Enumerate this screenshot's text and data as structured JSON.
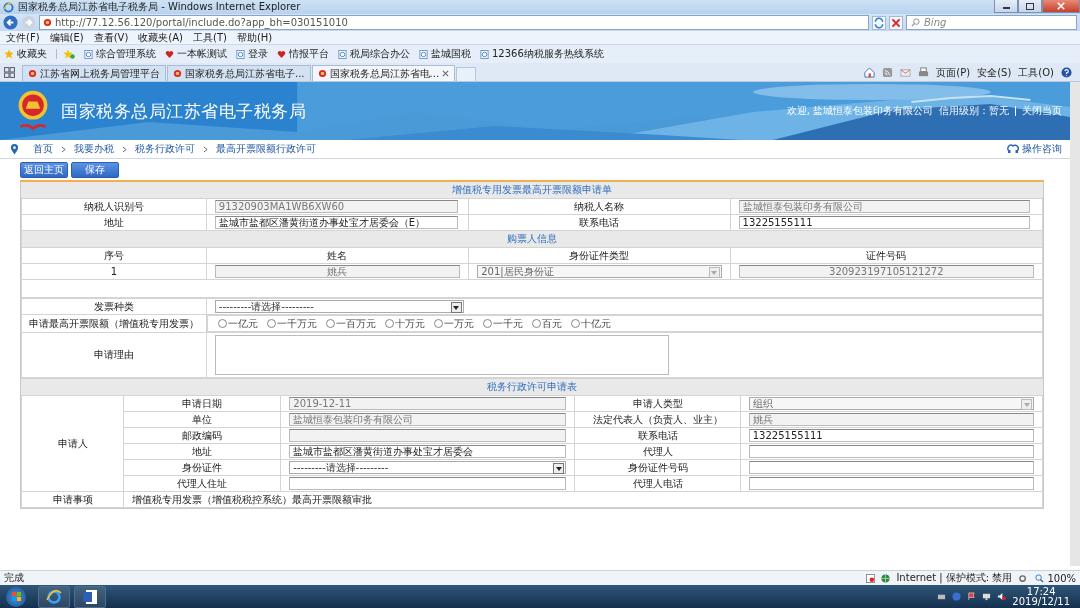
{
  "window": {
    "title": "国家税务总局江苏省电子税务局 - Windows Internet Explorer"
  },
  "address_bar": {
    "url": "http://77.12.56.120/portal/include.do?app_bh=030151010",
    "search_placeholder": "Bing"
  },
  "menu": [
    "文件(F)",
    "编辑(E)",
    "查看(V)",
    "收藏夹(A)",
    "工具(T)",
    "帮助(H)"
  ],
  "favorites": {
    "label": "收藏夹",
    "items": [
      {
        "label": "综合管理系统",
        "kind": "page"
      },
      {
        "label": "一本帐测试",
        "kind": "emblem"
      },
      {
        "label": "登录",
        "kind": "page"
      },
      {
        "label": "情报平台",
        "kind": "emblem"
      },
      {
        "label": "税局综合办公",
        "kind": "page"
      },
      {
        "label": "盐城国税",
        "kind": "page"
      },
      {
        "label": "12366纳税服务热线系统",
        "kind": "page"
      }
    ]
  },
  "browser_tabs": [
    {
      "label": "江苏省网上税务局管理平台",
      "selected": false
    },
    {
      "label": "国家税务总局江苏省电子...",
      "selected": false
    },
    {
      "label": "国家税务总局江苏省电...",
      "selected": true
    }
  ],
  "command_bar": [
    "页面(P)",
    "安全(S)",
    "工具(O)"
  ],
  "site_header": {
    "title": "国家税务总局江苏省电子税务局",
    "welcome": "欢迎, 盐城恒泰包装印务有限公司",
    "credit": "信用级别：暂无",
    "close_link": "关闭当页"
  },
  "breadcrumb": [
    "首页",
    "我要办税",
    "税务行政许可",
    "最高开票限额行政许可"
  ],
  "help_link": "操作咨询",
  "buttons": [
    "返回主页",
    "保存"
  ],
  "form": {
    "title": "增值税专用发票最高开票限额申请单",
    "taxpayer": [
      {
        "label": "纳税人识别号",
        "kind": "input",
        "value": "91320903MA1WB6XW60",
        "disabled": true
      },
      {
        "label": "纳税人名称",
        "kind": "input",
        "value": "盐城恒泰包装印务有限公司",
        "disabled": true
      },
      {
        "label": "地址",
        "kind": "input",
        "value": "盐城市盐都区潘黄街道办事处宝才居委会（E）",
        "disabled": false
      },
      {
        "label": "联系电话",
        "kind": "input",
        "value": "13225155111",
        "disabled": false
      }
    ],
    "buyer": {
      "title": "购票人信息",
      "columns": [
        "序号",
        "姓名",
        "身份证件类型",
        "证件号码"
      ],
      "rows": [
        [
          {
            "kind": "text",
            "value": "1"
          },
          {
            "kind": "input",
            "value": "姚兵",
            "disabled": true
          },
          {
            "kind": "select",
            "value": "201|居民身份证",
            "disabled": true
          },
          {
            "kind": "input",
            "value": "320923197105121272",
            "disabled": true
          }
        ]
      ]
    },
    "invoice_type": {
      "label": "发票种类",
      "value": "---------请选择---------"
    },
    "limit": {
      "label": "申请最高开票限额（增值税专用发票）",
      "options": [
        {
          "label": "一亿元",
          "selected": false
        },
        {
          "label": "一千万元",
          "selected": false
        },
        {
          "label": "一百万元",
          "selected": false
        },
        {
          "label": "十万元",
          "selected": false
        },
        {
          "label": "一万元",
          "selected": false
        },
        {
          "label": "一千元",
          "selected": false
        },
        {
          "label": "百元",
          "selected": false
        },
        {
          "label": "十亿元",
          "selected": false
        }
      ]
    },
    "reason": {
      "label": "申请理由"
    },
    "permit": {
      "title": "税务行政许可申请表",
      "applicant_label": "申请人",
      "rows": [
        [
          {
            "label": "申请日期",
            "kind": "input",
            "value": "2019-12-11",
            "disabled": true
          },
          {
            "label": "申请人类型",
            "kind": "select",
            "value": "组织",
            "disabled": true
          }
        ],
        [
          {
            "label": "单位",
            "kind": "input",
            "value": "盐城恒泰包装印务有限公司",
            "disabled": true
          },
          {
            "label": "法定代表人（负责人、业主）",
            "kind": "input",
            "value": "姚兵",
            "disabled": true
          }
        ],
        [
          {
            "label": "邮政编码",
            "kind": "input",
            "disabled": true
          },
          {
            "label": "联系电话",
            "kind": "input",
            "value": "13225155111",
            "disabled": false
          }
        ],
        [
          {
            "label": "地址",
            "kind": "input",
            "value": "盐城市盐都区潘黄街道办事处宝才居委会",
            "disabled": false
          },
          {
            "label": "代理人",
            "kind": "input",
            "disabled": false
          }
        ],
        [
          {
            "label": "身份证件",
            "kind": "select",
            "value": "---------请选择---------",
            "disabled": false
          },
          {
            "label": "身份证件号码",
            "kind": "input",
            "disabled": false
          }
        ],
        [
          {
            "label": "代理人住址",
            "kind": "input",
            "disabled": false
          },
          {
            "label": "代理人电话",
            "kind": "input",
            "disabled": false
          }
        ]
      ],
      "matter_label": "申请事项",
      "matter": "增值税专用发票（增值税税控系统）最高开票限额审批"
    }
  },
  "status_bar": {
    "status": "完成",
    "zone": "Internet | 保护模式: 禁用",
    "zoom": "100%"
  },
  "taskbar": {
    "time": "17:24",
    "date": "2019/12/11"
  }
}
